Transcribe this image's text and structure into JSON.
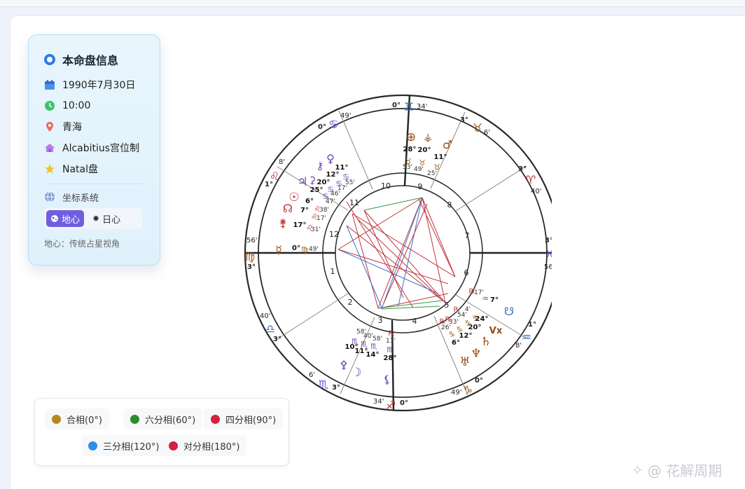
{
  "panel": {
    "title": "本命盘信息",
    "date": "1990年7月30日",
    "time": "10:00",
    "place": "青海",
    "house_system": "Alcabitius宫位制",
    "chart_type": "Natal盘",
    "coord_label": "坐标系统",
    "btn_geo": "地心",
    "btn_helio": "日心",
    "note": "地心：传统占星视角"
  },
  "legend": {
    "conjunction": "合相(0°)",
    "sextile": "六分相(60°)",
    "square": "四分相(90°)",
    "trine": "三分相(120°)",
    "opposition": "对分相(180°)"
  },
  "colors": {
    "conjunction": "#b8861b",
    "sextile": "#2e8b2e",
    "square": "#d4213d",
    "trine": "#2f8fe8",
    "opposition": "#d4213d",
    "accent": "#6f5fe0"
  },
  "chart": {
    "house_numbers": [
      "1",
      "2",
      "3",
      "4",
      "5",
      "6",
      "7",
      "8",
      "9",
      "10",
      "11",
      "12"
    ],
    "cusps": {
      "c10": "0°",
      "c10m": "34'",
      "c11": "3°",
      "c11m": "6'",
      "c12": "3°",
      "c12m": "40'",
      "c1": "3°",
      "c1m": "56'",
      "c2": "1°",
      "c2m": "8'",
      "c3": "0°",
      "c3m": "49'",
      "c4": "0°",
      "c4m": "34'",
      "c5": "3°",
      "c5m": "6'",
      "c6": "3°",
      "c6m": "40'",
      "c7": "3°",
      "c7m": "56'",
      "c8": "1°",
      "c8m": "8'",
      "c9": "0°",
      "c9m": "49'"
    },
    "planets": {
      "pof_deg": "28°",
      "pof_min": "53'",
      "vesta_deg": "20°",
      "vesta_min": "49'",
      "mars_deg": "11°",
      "mars_min": "25'",
      "venus_deg": "11°",
      "venus_min": "55'",
      "chiron_deg": "12°",
      "chiron_min": "17'",
      "jupiter_deg": "20°",
      "jupiter_min": "46'",
      "ceres_deg": "25°",
      "ceres_min": "47'",
      "sun_deg": "6°",
      "sun_min": "38'",
      "node_deg": "7°",
      "node_min": "17'",
      "juno_deg": "17°",
      "juno_min": "31'",
      "mercury_deg": "0°",
      "mercury_min": "49'",
      "snode_deg": "7°",
      "snode_min": "17'",
      "saturn_deg": "24°",
      "saturn_min": "4'",
      "vx_deg": "20°",
      "vx_min": "54'",
      "neptune_deg": "12°",
      "neptune_min": "33'",
      "uranus_deg": "6°",
      "uranus_min": "26'",
      "pallas_deg": "10°",
      "pallas_min": "58'",
      "moon_deg": "11°",
      "moon_min": "40'",
      "lilith_deg": "14°",
      "lilith_min": "58'",
      "pluto_deg": "28°",
      "pluto_min": "13'"
    }
  },
  "watermark": "@ 花解周期"
}
